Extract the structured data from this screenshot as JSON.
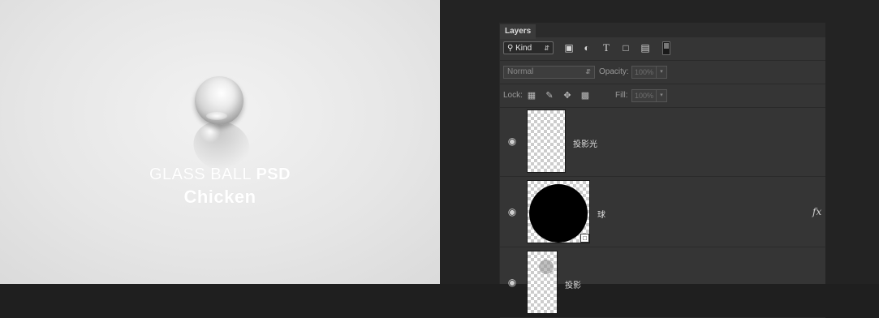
{
  "artwork": {
    "title_light": "GLASS BALL ",
    "title_bold": "PSD",
    "subtitle": "Chicken"
  },
  "layers_panel": {
    "tab_label": "Layers",
    "filter": {
      "kind_label": "Kind",
      "icons": [
        "image-filter-icon",
        "adjustment-filter-icon",
        "type-filter-icon",
        "shape-filter-icon",
        "smart-object-filter-icon"
      ]
    },
    "blend_mode": "Normal",
    "opacity_label": "Opacity:",
    "opacity_value": "100%",
    "lock_label": "Lock:",
    "fill_label": "Fill:",
    "fill_value": "100%",
    "layers": [
      {
        "name": "投影光",
        "visible": true,
        "has_fx": false
      },
      {
        "name": "球",
        "visible": true,
        "has_fx": true,
        "fx_label": "fx"
      },
      {
        "name": "投影",
        "visible": true,
        "has_fx": false
      }
    ]
  }
}
